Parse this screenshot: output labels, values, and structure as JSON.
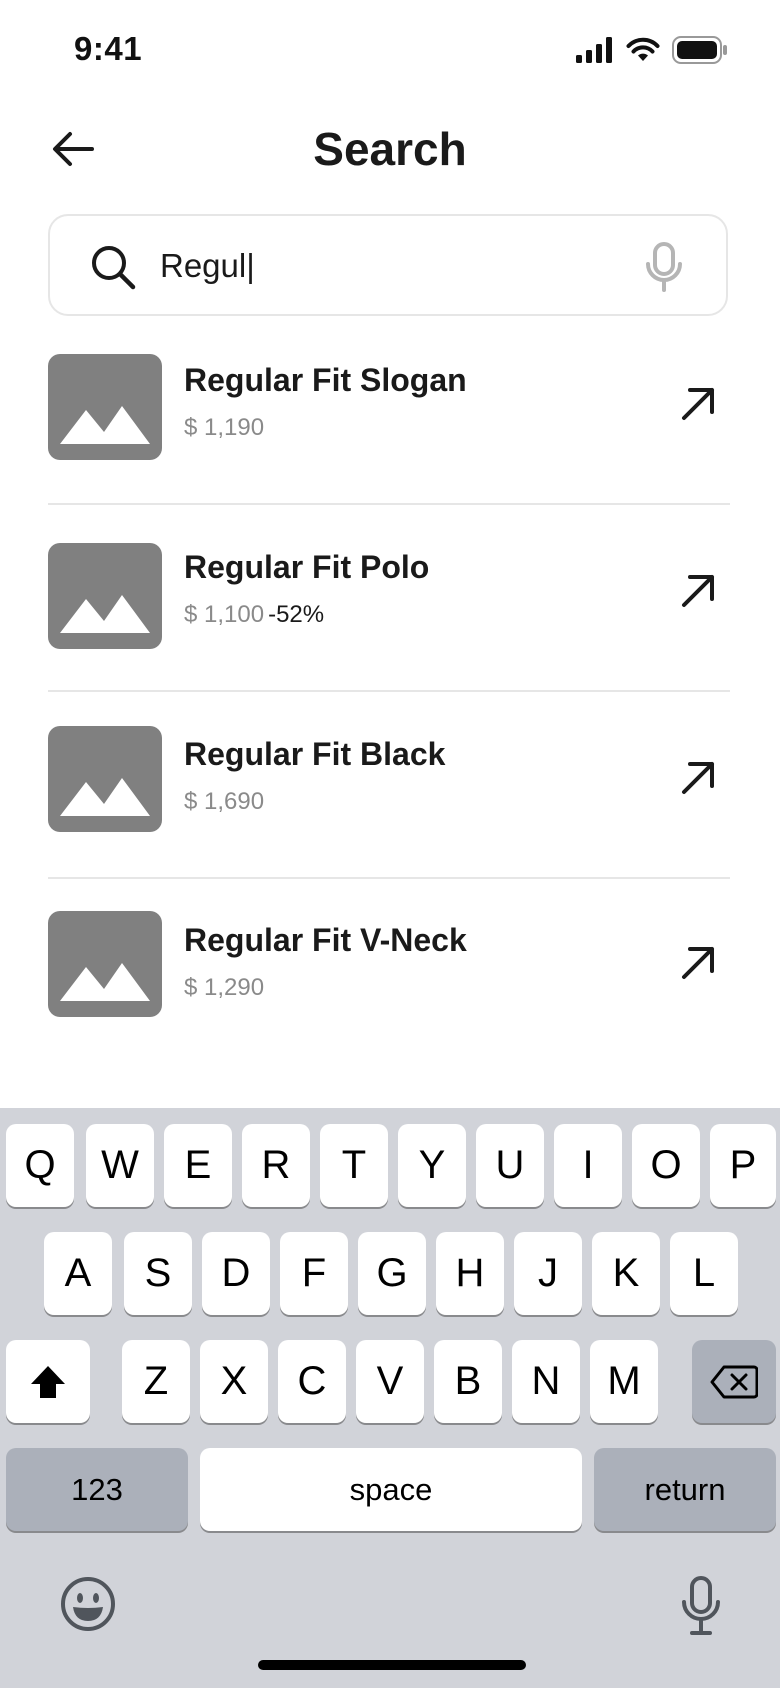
{
  "status": {
    "time": "9:41"
  },
  "header": {
    "title": "Search"
  },
  "search": {
    "value": "Regul|"
  },
  "results": [
    {
      "name": "Regular Fit Slogan",
      "price": "$ 1,190",
      "discount": ""
    },
    {
      "name": "Regular Fit Polo",
      "price": "$ 1,100",
      "discount": "-52%"
    },
    {
      "name": "Regular Fit Black",
      "price": "$ 1,690",
      "discount": ""
    },
    {
      "name": "Regular Fit V-Neck",
      "price": "$ 1,290",
      "discount": ""
    }
  ],
  "keyboard": {
    "row1": [
      "Q",
      "W",
      "E",
      "R",
      "T",
      "Y",
      "U",
      "I",
      "O",
      "P"
    ],
    "row2": [
      "A",
      "S",
      "D",
      "F",
      "G",
      "H",
      "J",
      "K",
      "L"
    ],
    "row3": [
      "Z",
      "X",
      "C",
      "V",
      "B",
      "N",
      "M"
    ],
    "numbers_label": "123",
    "space_label": "space",
    "return_label": "return"
  },
  "icons": {
    "status": [
      "signal-icon",
      "wifi-icon",
      "battery-icon"
    ],
    "header": "back-arrow-icon",
    "search": [
      "search-icon",
      "microphone-icon"
    ],
    "result": [
      "image-placeholder-icon",
      "arrow-up-right-icon"
    ],
    "keyboard": [
      "shift-icon",
      "backspace-icon",
      "emoji-icon",
      "dictation-mic-icon"
    ]
  },
  "colors": {
    "text": "#1a1a1a",
    "muted": "#8a8a8a",
    "placeholder_image": "#808080",
    "divider": "#e6e6e6",
    "keyboard_bg": "#d1d3d9",
    "key_dark": "#abb0ba"
  }
}
